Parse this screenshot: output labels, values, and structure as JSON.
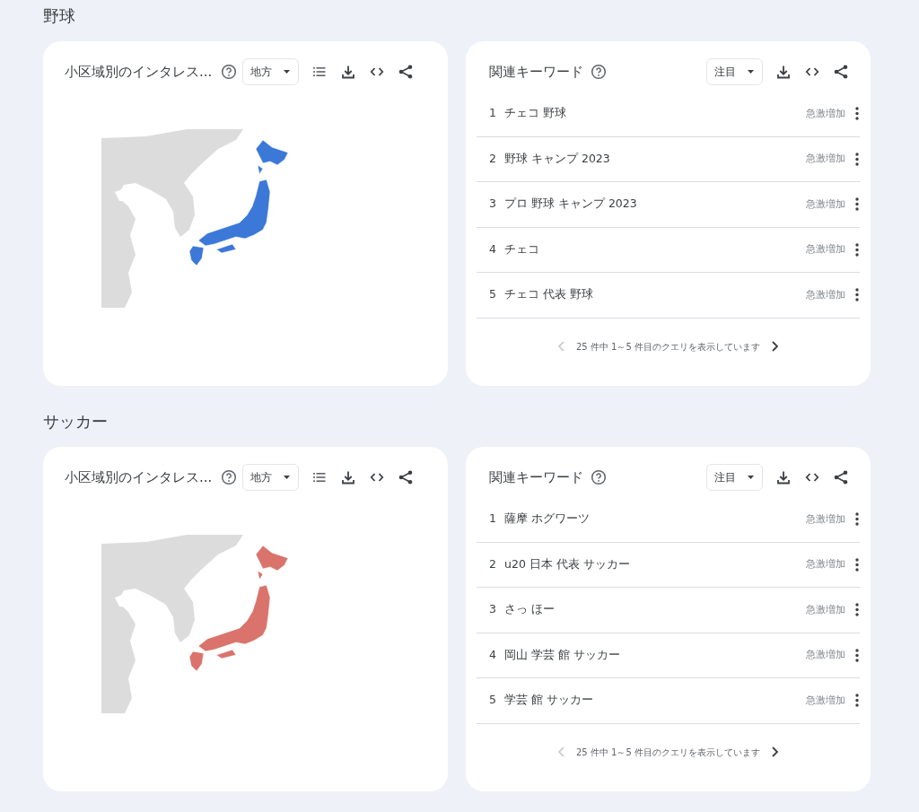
{
  "sections": [
    {
      "title": "野球",
      "map_card": {
        "title": "小区域別のインタレス...",
        "dropdown": "地方",
        "color": "#3b78d8"
      },
      "keywords_card": {
        "title": "関連キーワード",
        "dropdown": "注目",
        "rows": [
          {
            "rank": "1",
            "query": "チェコ 野球",
            "trend": "急激増加"
          },
          {
            "rank": "2",
            "query": "野球 キャンプ 2023",
            "trend": "急激増加"
          },
          {
            "rank": "3",
            "query": "プロ 野球 キャンプ 2023",
            "trend": "急激増加"
          },
          {
            "rank": "4",
            "query": "チェコ",
            "trend": "急激増加"
          },
          {
            "rank": "5",
            "query": "チェコ 代表 野球",
            "trend": "急激増加"
          }
        ],
        "pagination": {
          "text": "25 件中 1～5 件目のクエリを表示しています",
          "prev_disabled": true,
          "next_disabled": false
        }
      }
    },
    {
      "title": "サッカー",
      "map_card": {
        "title": "小区域別のインタレス...",
        "dropdown": "地方",
        "color": "#d9736b"
      },
      "keywords_card": {
        "title": "関連キーワード",
        "dropdown": "注目",
        "rows": [
          {
            "rank": "1",
            "query": "薩摩 ホグワーツ",
            "trend": "急激増加"
          },
          {
            "rank": "2",
            "query": "u20 日本 代表 サッカー",
            "trend": "急激増加"
          },
          {
            "rank": "3",
            "query": "さっ ほー",
            "trend": "急激増加"
          },
          {
            "rank": "4",
            "query": "岡山 学芸 館 サッカー",
            "trend": "急激増加"
          },
          {
            "rank": "5",
            "query": "学芸 館 サッカー",
            "trend": "急激増加"
          }
        ],
        "pagination": {
          "text": "25 件中 1～5 件目のクエリを表示しています",
          "prev_disabled": true,
          "next_disabled": false
        }
      }
    }
  ]
}
